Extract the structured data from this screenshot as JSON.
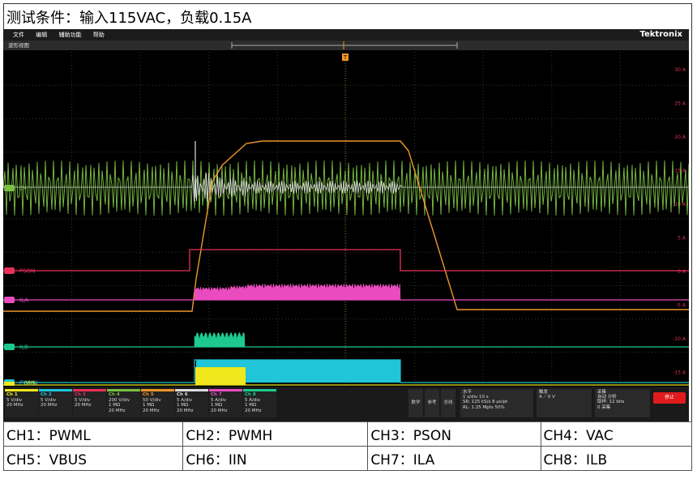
{
  "caption": "测试条件：输入115VAC，负载0.15A",
  "scope": {
    "menu": [
      "文件",
      "编辑",
      "辅助功能",
      "帮助"
    ],
    "brand": "Tektronix",
    "view_label": "波形视图",
    "trigger_marker": "T",
    "right_scale": [
      "30 A",
      "25 A",
      "20 A",
      "15 A",
      "10 A",
      "5 A",
      "0 A",
      "-5 A",
      "-10 A",
      "-15 A"
    ],
    "trace_labels": {
      "vac": "C4",
      "pson": "PSON",
      "ila": "ILA",
      "ilb": "ILB",
      "pwmh": "PWMH",
      "pwml": "PWML"
    },
    "trace_colors": {
      "vac": "#7bc043",
      "vbus": "#f0962a",
      "pson": "#e9305a",
      "ila": "#ea4cc0",
      "ilb": "#1ec98f",
      "pwmh": "#21c5d8",
      "pwml": "#f0e81c",
      "iin": "#dddddd"
    },
    "channels": [
      {
        "name": "Ch 1",
        "lines": [
          "5 V/div",
          "20 MHz"
        ],
        "color": "#f0e81c"
      },
      {
        "name": "Ch 2",
        "lines": [
          "5 V/div",
          "20 MHz"
        ],
        "color": "#21c5d8"
      },
      {
        "name": "Ch 3",
        "lines": [
          "5 V/div",
          "20 MHz"
        ],
        "color": "#e9305a"
      },
      {
        "name": "Ch 4",
        "lines": [
          "200 V/div",
          "1 MΩ",
          "20 MHz"
        ],
        "color": "#7bc043"
      },
      {
        "name": "Ch 5",
        "lines": [
          "50 V/div",
          "1 MΩ",
          "20 MHz"
        ],
        "color": "#f0962a"
      },
      {
        "name": "Ch 6",
        "lines": [
          "5 A/div",
          "1 MΩ",
          "20 MHz"
        ],
        "color": "#dddddd"
      },
      {
        "name": "Ch 7",
        "lines": [
          "5 A/div",
          "1 MΩ",
          "20 MHz"
        ],
        "color": "#ea4cc0"
      },
      {
        "name": "Ch 8",
        "lines": [
          "5 A/div",
          "1 MΩ",
          "20 MHz"
        ],
        "color": "#1ec98f"
      }
    ],
    "side_buttons": [
      "数学",
      "参考",
      "总线"
    ],
    "horizontal": {
      "title": "水平",
      "lines": [
        "1 s/div    10 s",
        "SR: 125 kS/s   8 µs/pt",
        "RL: 1.25 Mpts   50%"
      ]
    },
    "trigger": {
      "title": "触发",
      "lines": [
        "4  ⟋  0 V"
      ]
    },
    "acquire": {
      "title": "采集",
      "lines": [
        "自动    分析",
        "取样: 12 bits",
        "0 采集"
      ]
    },
    "stop_label": "停止"
  },
  "legend": [
    [
      "CH1：PWML",
      "CH2：PWMH",
      "CH3：PSON",
      "CH4：VAC"
    ],
    [
      "CH5：VBUS",
      "CH6：IIN",
      "CH7：ILA",
      "CH8：ILB"
    ]
  ]
}
